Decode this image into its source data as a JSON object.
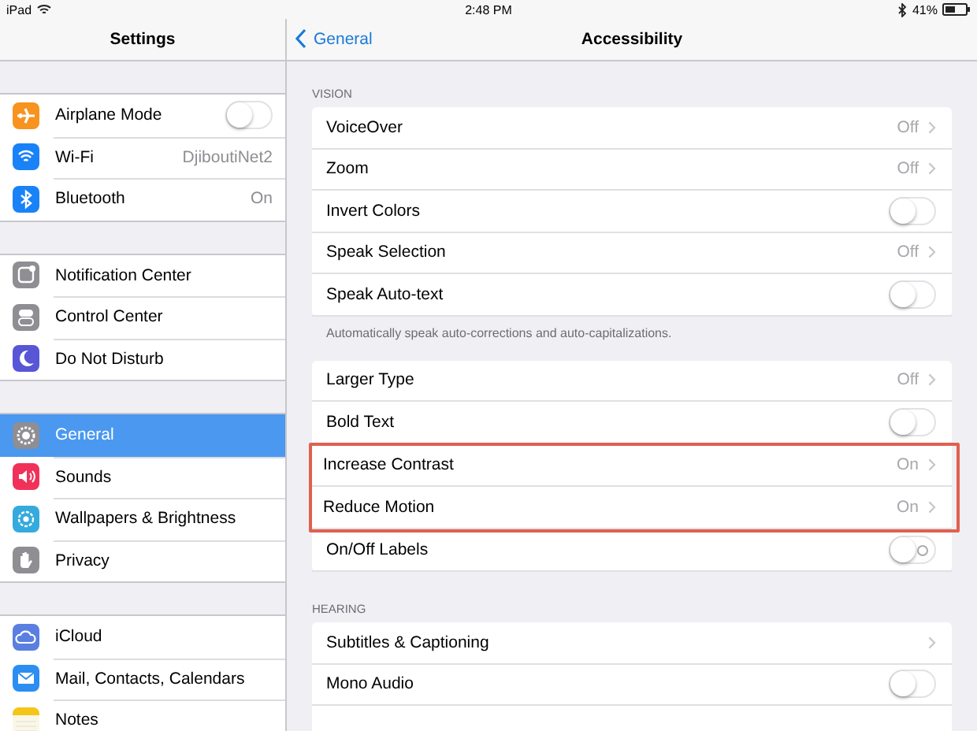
{
  "status_bar": {
    "device": "iPad",
    "time": "2:48 PM",
    "battery": "41%"
  },
  "sidebar": {
    "title": "Settings",
    "groups": [
      [
        {
          "label": "Airplane Mode",
          "kind": "toggle",
          "on": false,
          "color": "#f7931e",
          "selected": false
        },
        {
          "label": "Wi-Fi",
          "kind": "value",
          "value": "DjiboutiNet2",
          "color": "#1a82f7",
          "selected": false
        },
        {
          "label": "Bluetooth",
          "kind": "value",
          "value": "On",
          "color": "#1a82f7",
          "selected": false
        }
      ],
      [
        {
          "label": "Notification Center",
          "kind": "plain",
          "color": "#8e8e93",
          "selected": false
        },
        {
          "label": "Control Center",
          "kind": "plain",
          "color": "#8e8e93",
          "selected": false
        },
        {
          "label": "Do Not Disturb",
          "kind": "plain",
          "color": "#5856d6",
          "selected": false
        }
      ],
      [
        {
          "label": "General",
          "kind": "plain",
          "color": "#8e8e93",
          "selected": true
        },
        {
          "label": "Sounds",
          "kind": "plain",
          "color": "#f0325a",
          "selected": false
        },
        {
          "label": "Wallpapers & Brightness",
          "kind": "plain",
          "color": "#35aadc",
          "selected": false
        },
        {
          "label": "Privacy",
          "kind": "plain",
          "color": "#8e8e93",
          "selected": false
        }
      ],
      [
        {
          "label": "iCloud",
          "kind": "plain",
          "color": "#5a7fe0",
          "selected": false
        },
        {
          "label": "Mail, Contacts, Calendars",
          "kind": "plain",
          "color": "#2b8ef0",
          "selected": false
        },
        {
          "label": "Notes",
          "kind": "plain",
          "color": "#f5c518",
          "selected": false
        }
      ]
    ]
  },
  "detail": {
    "back": "General",
    "title": "Accessibility",
    "sections": [
      {
        "header": "VISION",
        "footer": "Automatically speak auto-corrections and auto-capitalizations.",
        "rows": [
          {
            "label": "VoiceOver",
            "kind": "value",
            "value": "Off",
            "highlighted": false
          },
          {
            "label": "Zoom",
            "kind": "value",
            "value": "Off",
            "highlighted": false
          },
          {
            "label": "Invert Colors",
            "kind": "toggle",
            "on": false,
            "highlighted": false
          },
          {
            "label": "Speak Selection",
            "kind": "value",
            "value": "Off",
            "highlighted": false
          },
          {
            "label": "Speak Auto-text",
            "kind": "toggle",
            "on": false,
            "highlighted": false
          }
        ]
      },
      {
        "rows": [
          {
            "label": "Larger Type",
            "kind": "value",
            "value": "Off",
            "highlighted": false
          },
          {
            "label": "Bold Text",
            "kind": "toggle",
            "on": false,
            "highlighted": false
          },
          {
            "label": "Increase Contrast",
            "kind": "value",
            "value": "On",
            "highlighted": true
          },
          {
            "label": "Reduce Motion",
            "kind": "value",
            "value": "On",
            "highlighted": true
          },
          {
            "label": "On/Off Labels",
            "kind": "labeled_toggle",
            "on": false,
            "highlighted": false
          }
        ]
      },
      {
        "header": "HEARING",
        "rows": [
          {
            "label": "Subtitles & Captioning",
            "kind": "link",
            "highlighted": false
          },
          {
            "label": "Mono Audio",
            "kind": "toggle",
            "on": false,
            "highlighted": false
          },
          {
            "kind": "blank",
            "highlighted": false
          }
        ]
      }
    ]
  }
}
